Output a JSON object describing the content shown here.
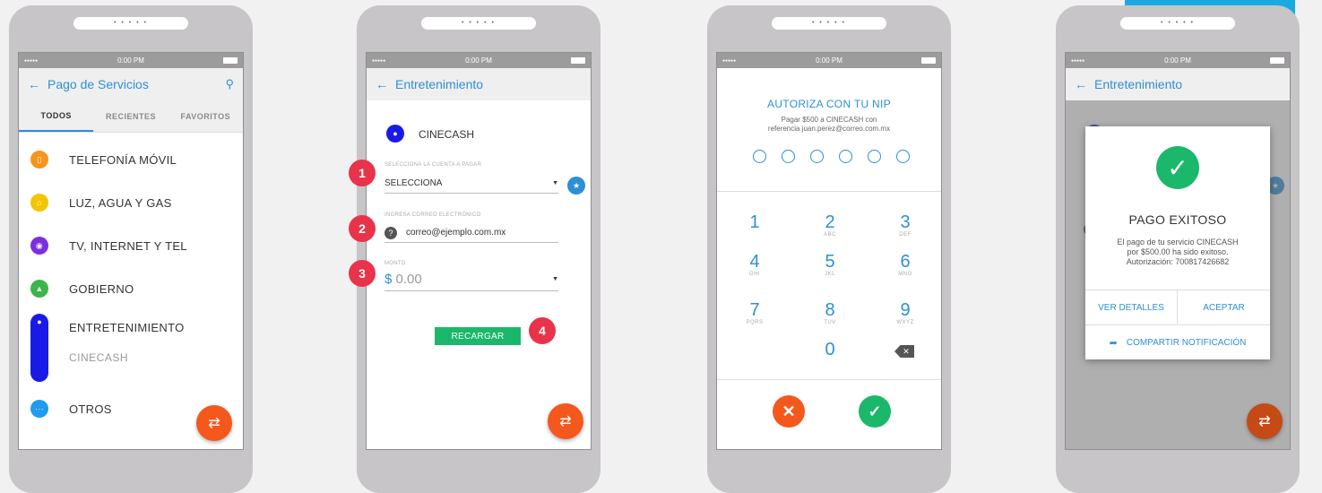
{
  "status": {
    "signal": "●●●●●",
    "time": "0:00 PM"
  },
  "speaker_dots": "• • • • •",
  "screen1": {
    "title": "Pago de Servicios",
    "tabs": [
      "TODOS",
      "RECIENTES",
      "FAVORITOS"
    ],
    "categories": [
      {
        "label": "TELEFONÍA MÓVIL",
        "color": "#f7941d",
        "icon": "phone-icon",
        "glyph": "▯"
      },
      {
        "label": "LUZ, AGUA Y GAS",
        "color": "#f5c400",
        "icon": "home-icon",
        "glyph": "⌂"
      },
      {
        "label": "TV, INTERNET Y TEL",
        "color": "#7b2fe0",
        "icon": "satellite-icon",
        "glyph": "◉"
      },
      {
        "label": "GOBIERNO",
        "color": "#3cb54a",
        "icon": "government-icon",
        "glyph": "▲"
      }
    ],
    "entertainment": {
      "label": "ENTRETENIMIENTO",
      "sub": "CINECASH",
      "color": "#1a1ae6"
    },
    "others": {
      "label": "OTROS",
      "color": "#1f9bf0",
      "glyph": "···"
    }
  },
  "screen2": {
    "title": "Entretenimiento",
    "service": "CINECASH",
    "account_label": "SELECCIONA LA CUENTA A PAGAR",
    "account_value": "SELECCIONA",
    "email_label": "INGRESA CORREO ELECTRÓNICO",
    "email_value": "correo@ejemplo.com.mx",
    "amount_label": "MONTO",
    "amount_currency": "$",
    "amount_value": "0.00",
    "button": "RECARGAR",
    "badges": [
      "1",
      "2",
      "3",
      "4"
    ]
  },
  "screen3": {
    "title": "AUTORIZA CON TU NIP",
    "desc_line1": "Pagar $500 a CINECASH con",
    "desc_line2": "referencia  juan.perez@correo.com.mx",
    "keys": [
      {
        "num": "1",
        "letters": ""
      },
      {
        "num": "2",
        "letters": "ABC"
      },
      {
        "num": "3",
        "letters": "DEF"
      },
      {
        "num": "4",
        "letters": "GHI"
      },
      {
        "num": "5",
        "letters": "JKL"
      },
      {
        "num": "6",
        "letters": "MNO"
      },
      {
        "num": "7",
        "letters": "PQRS"
      },
      {
        "num": "8",
        "letters": "TUV"
      },
      {
        "num": "9",
        "letters": "WXYZ"
      },
      {
        "num": "0",
        "letters": ""
      }
    ]
  },
  "screen4": {
    "title": "Entretenimiento",
    "modal_title": "PAGO EXITOSO",
    "modal_line1": "El pago de tu servicio CINECASH",
    "modal_line2": "por $500.00 ha sido exitoso.",
    "modal_line3": "Autorización: 700817426682",
    "details_button": "VER DETALLES",
    "accept_button": "ACEPTAR",
    "share_button": "COMPARTIR NOTIFICACIÓN"
  }
}
